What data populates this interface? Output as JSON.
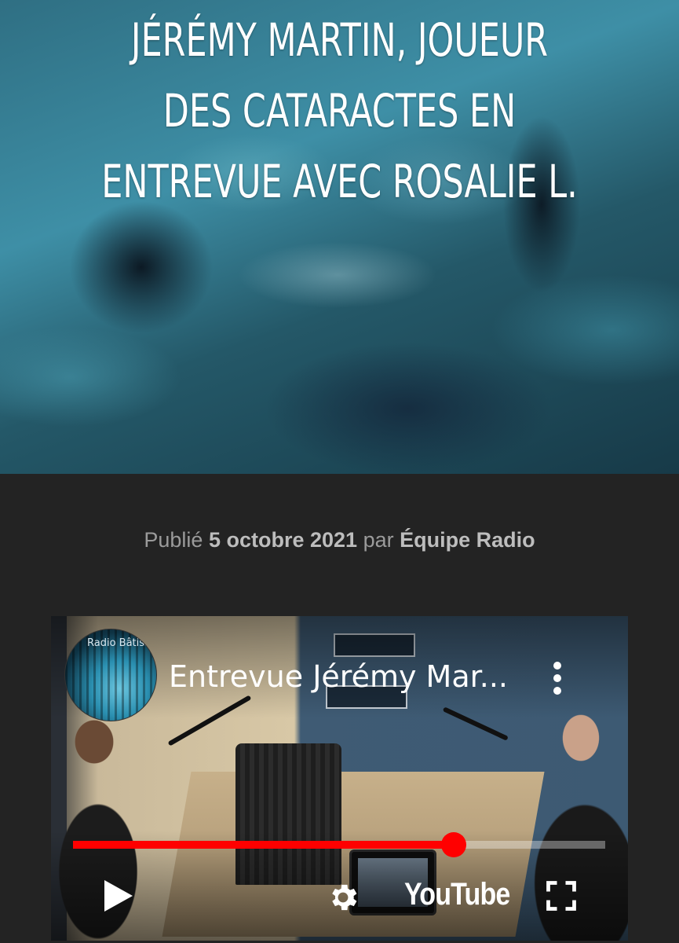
{
  "hero": {
    "title_lines": [
      "JÉRÉMY MARTIN, JOUEUR",
      "DES CATARACTES EN",
      "ENTREVUE AVEC ROSALIE L."
    ]
  },
  "meta": {
    "published_label": "Publié",
    "date": "5 octobre 2021",
    "by_label": "par",
    "author": "Équipe Radio"
  },
  "video": {
    "title": "Entrevue Jérémy Mar...",
    "channel_avatar_text": "Radio Bâtisseurs",
    "logo_text": "YouTube",
    "progress": 0.715,
    "icons": [
      "kebab-menu-icon",
      "play-icon",
      "gear-icon",
      "fullscreen-icon"
    ],
    "accent_color": "#ff0000"
  }
}
